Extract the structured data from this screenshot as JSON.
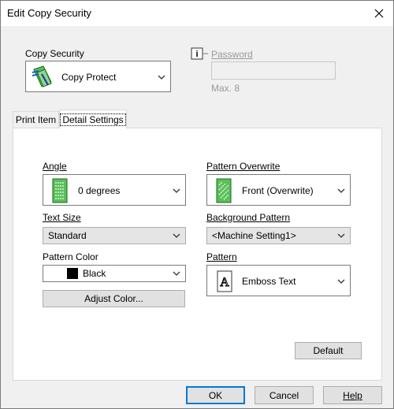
{
  "window": {
    "title": "Edit Copy Security"
  },
  "copy_security": {
    "label": "Copy Security",
    "value": "Copy Protect"
  },
  "password": {
    "label": "Password",
    "value": "",
    "hint": "Max. 8"
  },
  "tabs": [
    {
      "label": "Print Item",
      "active": false
    },
    {
      "label": "Detail Settings",
      "active": true
    }
  ],
  "detail": {
    "angle": {
      "label": "Angle",
      "value": "0 degrees"
    },
    "text_size": {
      "label": "Text Size",
      "value": "Standard"
    },
    "pattern_color": {
      "label": "Pattern Color",
      "value": "Black",
      "swatch": "#000000"
    },
    "adjust_color_label": "Adjust Color...",
    "pattern_overwrite": {
      "label": "Pattern Overwrite",
      "value": "Front (Overwrite)"
    },
    "background_pattern": {
      "label": "Background Pattern",
      "value": "<Machine Setting1>"
    },
    "pattern": {
      "label": "Pattern",
      "value": "Emboss Text"
    },
    "default_label": "Default"
  },
  "footer": {
    "ok": "OK",
    "cancel": "Cancel",
    "help": "Help"
  },
  "colors": {
    "accent": "#0078d7",
    "icon_green": "#3cb44b"
  }
}
